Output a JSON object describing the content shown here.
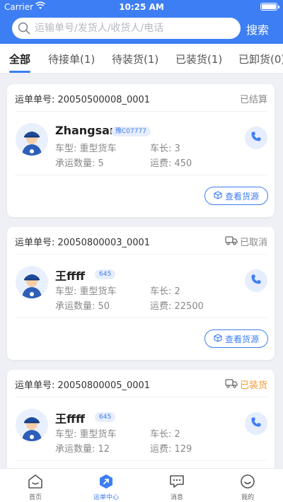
{
  "status_bar": {
    "carrier": "Carrier",
    "time": "10:25 AM"
  },
  "search": {
    "placeholder": "运输单号/发货人/收货人/电话",
    "button_label": "搜索"
  },
  "tabs": [
    {
      "label": "全部",
      "active": true
    },
    {
      "label": "待接单(1)",
      "active": false
    },
    {
      "label": "待装货(1)",
      "active": false
    },
    {
      "label": "已装货(1)",
      "active": false
    },
    {
      "label": "已卸货(0)",
      "active": false
    }
  ],
  "orders": [
    {
      "order_no": "运单单号: 20050500008_0001",
      "status": "已结算",
      "driver_name": "Zhangsan",
      "plate": "豫C07777",
      "vehicle_type": "车型: 重型货车",
      "vehicle_length": "车长: 3",
      "quantity": "承运数量: 5",
      "freight": "运费: 450",
      "source_button": "查看货源"
    },
    {
      "order_no": "运单单号: 20050800003_0001",
      "status": "已取消",
      "driver_name": "王ffff",
      "plate": "645",
      "vehicle_type": "车型: 重型货车",
      "vehicle_length": "车长: 2",
      "quantity": "承运数量: 50",
      "freight": "运费: 22500",
      "source_button": "查看货源"
    },
    {
      "order_no": "运单单号: 20050800005_0001",
      "status": "已装货",
      "driver_name": "王ffff",
      "plate": "645",
      "vehicle_type": "车型: 重型货车",
      "vehicle_length": "车长: 2",
      "quantity": "承运数量: 12",
      "freight": "运费: 129"
    }
  ],
  "tabbar": [
    {
      "label": "首页",
      "icon": "home-icon"
    },
    {
      "label": "运单中心",
      "icon": "waybill-center-icon"
    },
    {
      "label": "消息",
      "icon": "message-icon"
    },
    {
      "label": "我的",
      "icon": "profile-icon"
    }
  ],
  "colors": {
    "primary": "#3d7ef4",
    "status_orange": "#f29b38",
    "status_gray": "#888888",
    "background": "#eef0f5"
  }
}
